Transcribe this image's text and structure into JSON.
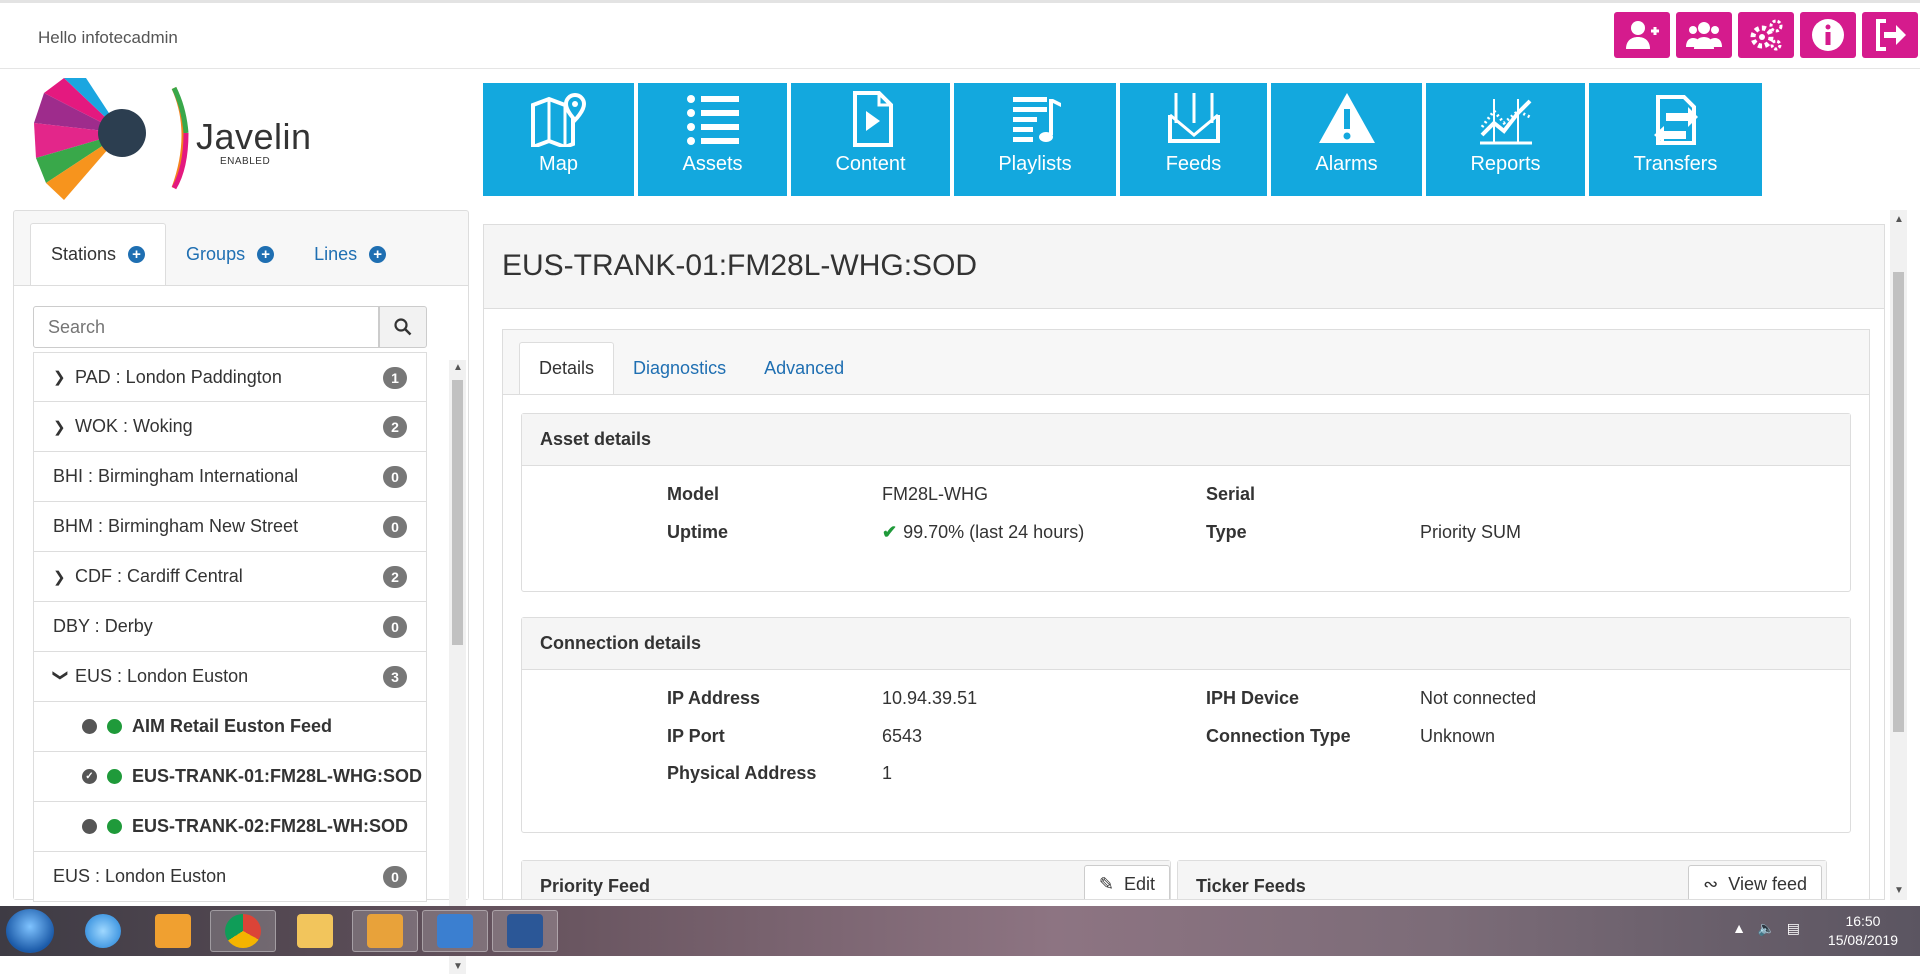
{
  "header": {
    "greeting": "Hello infotecadmin",
    "icons": [
      "add-user-icon",
      "users-icon",
      "settings-icon",
      "info-icon",
      "logout-icon"
    ]
  },
  "logo": {
    "name": "Javelin",
    "sub": "ENABLED"
  },
  "nav": [
    {
      "label": "Map",
      "icon": "map-icon"
    },
    {
      "label": "Assets",
      "icon": "list-icon"
    },
    {
      "label": "Content",
      "icon": "file-play-icon"
    },
    {
      "label": "Playlists",
      "icon": "playlist-icon"
    },
    {
      "label": "Feeds",
      "icon": "feeds-icon"
    },
    {
      "label": "Alarms",
      "icon": "warning-icon"
    },
    {
      "label": "Reports",
      "icon": "chart-icon"
    },
    {
      "label": "Transfers",
      "icon": "transfer-icon"
    }
  ],
  "sidebar": {
    "tabs": [
      "Stations",
      "Groups",
      "Lines"
    ],
    "search_placeholder": "Search",
    "items": [
      {
        "label": "PAD : London Paddington",
        "count": "1"
      },
      {
        "label": "WOK : Woking",
        "count": "2"
      },
      {
        "label": "BHI : Birmingham International",
        "count": "0"
      },
      {
        "label": "BHM : Birmingham New Street",
        "count": "0"
      },
      {
        "label": "CDF : Cardiff Central",
        "count": "2"
      },
      {
        "label": "DBY : Derby",
        "count": "0"
      },
      {
        "label": "EUS : London Euston",
        "count": "3"
      },
      {
        "label": "AIM Retail Euston Feed"
      },
      {
        "label": "EUS-TRANK-01:FM28L-WHG:SOD"
      },
      {
        "label": "EUS-TRANK-02:FM28L-WH:SOD"
      },
      {
        "label": "EUS : London Euston",
        "count": "0"
      }
    ]
  },
  "main": {
    "title": "EUS-TRANK-01:FM28L-WHG:SOD",
    "tabs": [
      "Details",
      "Diagnostics",
      "Advanced"
    ],
    "asset_details": {
      "heading": "Asset details",
      "model_label": "Model",
      "model": "FM28L-WHG",
      "uptime_label": "Uptime",
      "uptime": "99.70% (last 24 hours)",
      "serial_label": "Serial",
      "type_label": "Type",
      "type": "Priority SUM"
    },
    "connection_details": {
      "heading": "Connection details",
      "ip_label": "IP Address",
      "ip": "10.94.39.51",
      "port_label": "IP Port",
      "port": "6543",
      "phys_label": "Physical Address",
      "phys": "1",
      "iph_label": "IPH Device",
      "iph": "Not connected",
      "conn_label": "Connection Type",
      "conn": "Unknown"
    },
    "priority_feed": {
      "heading": "Priority Feed",
      "button": "Edit"
    },
    "ticker_feeds": {
      "heading": "Ticker Feeds",
      "button": "View feed"
    }
  },
  "taskbar": {
    "time": "16:50",
    "date": "15/08/2019"
  }
}
